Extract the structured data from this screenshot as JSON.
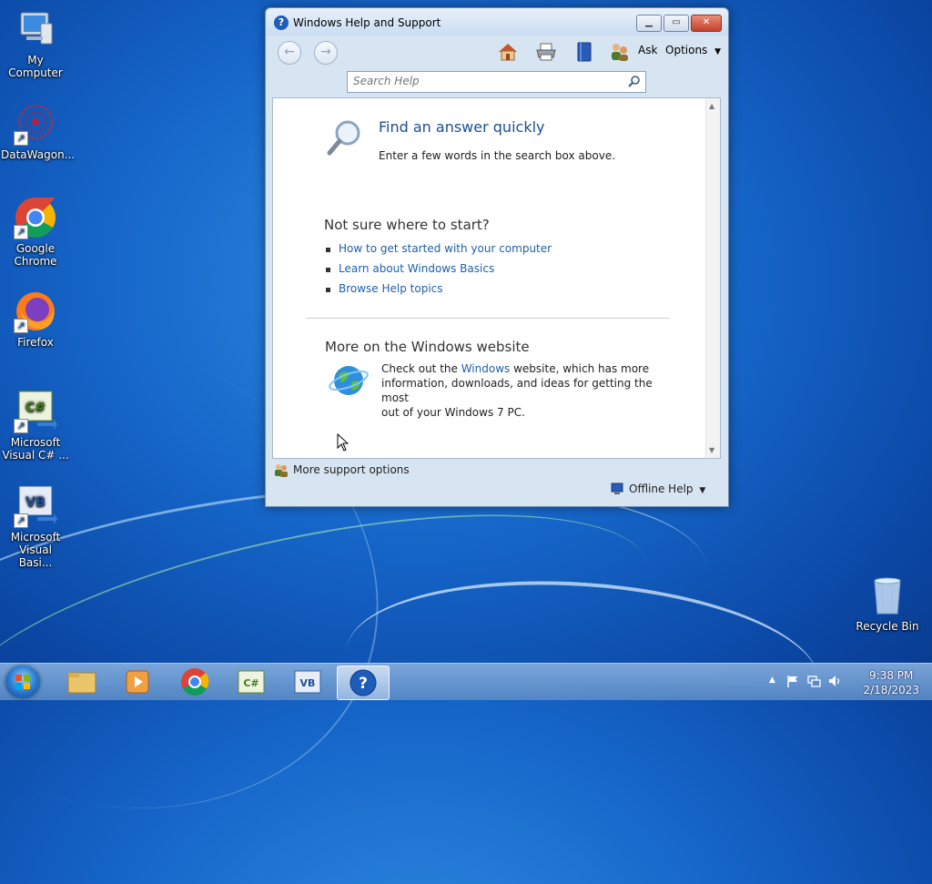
{
  "desktop": {
    "icons": [
      {
        "label": "My Computer"
      },
      {
        "label": "DataWagon..."
      },
      {
        "label": "Google Chrome"
      },
      {
        "label": "Firefox"
      },
      {
        "label": "Microsoft Visual C# ..."
      },
      {
        "label": "Microsoft Visual Basi..."
      },
      {
        "label": "Recycle Bin"
      }
    ]
  },
  "window": {
    "title": "Windows Help and Support",
    "toolbar": {
      "ask_label": "Ask",
      "options_label": "Options"
    },
    "search": {
      "placeholder": "Search Help"
    },
    "content": {
      "find_heading": "Find an answer quickly",
      "find_text": "Enter a few words in the search box above.",
      "notsure_heading": "Not sure where to start?",
      "links": [
        "How to get started with your computer",
        "Learn about Windows Basics",
        "Browse Help topics"
      ],
      "website_heading": "More on the Windows website",
      "website_text_1": "Check out the ",
      "website_link": "Windows",
      "website_text_2": " website, which has more",
      "website_text_3": "information, downloads, and ideas for getting the most",
      "website_text_4": "out of your Windows 7 PC."
    },
    "status": {
      "more_support": "More support options",
      "offline_help": "Offline Help"
    }
  },
  "taskbar": {
    "time": "9:38 PM",
    "date": "2/18/2023"
  }
}
